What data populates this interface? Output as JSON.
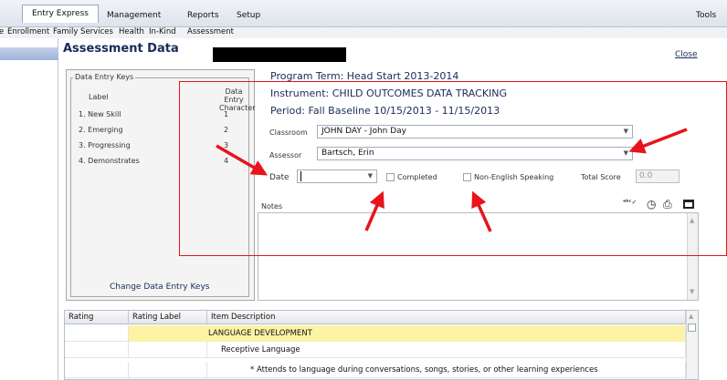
{
  "menu": {
    "tabs": [
      "Entry Express",
      "Management",
      "Reports",
      "Setup"
    ],
    "tools": "Tools"
  },
  "subnav": [
    "e",
    "Enrollment",
    "Family Services",
    "Health",
    "In-Kind",
    "Assessment"
  ],
  "page": {
    "title": "Assessment Data",
    "close": "Close"
  },
  "keys": {
    "legend": "Data Entry Keys",
    "label_header": "Label",
    "char_header": "Data Entry Character",
    "items": [
      {
        "label": "1. New Skill",
        "char": "1"
      },
      {
        "label": "2. Emerging",
        "char": "2"
      },
      {
        "label": "3. Progressing",
        "char": "3"
      },
      {
        "label": "4. Demonstrates",
        "char": "4"
      }
    ],
    "change_link": "Change Data Entry Keys"
  },
  "info": {
    "program_term": "Program Term:  Head Start 2013-2014",
    "instrument": "Instrument:  CHILD OUTCOMES DATA TRACKING",
    "period": "Period:  Fall Baseline   10/15/2013 - 11/15/2013"
  },
  "form": {
    "classroom_label": "Classroom",
    "classroom_value": "JOHN DAY - John Day",
    "assessor_label": "Assessor",
    "assessor_value": "Bartsch, Erin",
    "date_label": "Date",
    "date_value": "",
    "completed_label": "Completed",
    "non_english_label": "Non-English Speaking",
    "total_score_label": "Total Score",
    "total_score_value": "0.0",
    "notes_label": "Notes"
  },
  "table": {
    "headers": [
      "Rating",
      "Rating Label",
      "Item Description"
    ],
    "rows": [
      {
        "description": "LANGUAGE DEVELOPMENT"
      },
      {
        "description": "Receptive Language"
      },
      {
        "description": "* Attends to language during conversations, songs, stories, or other learning experiences"
      }
    ]
  },
  "colors": {
    "annotation_red": "#e8131b",
    "category_highlight": "#fcf3a5",
    "header_blue": "#1a2a5a"
  }
}
